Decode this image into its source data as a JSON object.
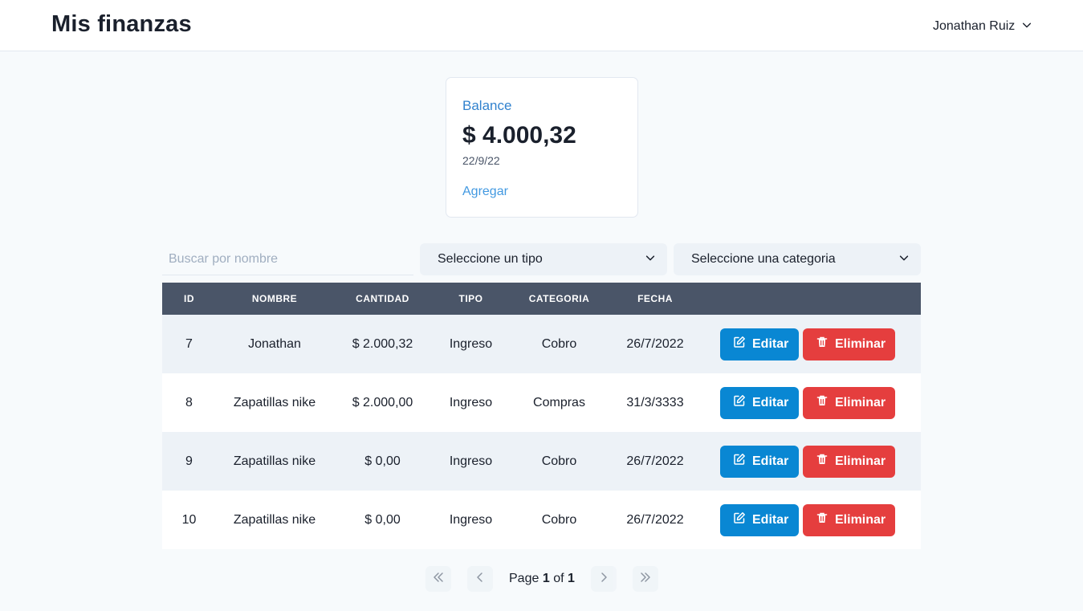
{
  "header": {
    "brand": "Mis finanzas",
    "user_name": "Jonathan Ruiz"
  },
  "balance": {
    "label": "Balance",
    "amount": "$ 4.000,32",
    "date": "22/9/22",
    "add_label": "Agregar"
  },
  "filters": {
    "search_placeholder": "Buscar por nombre",
    "tipo_selected": "Seleccione un tipo",
    "categoria_selected": "Seleccione una categoria"
  },
  "table": {
    "columns": [
      "ID",
      "NOMBRE",
      "CANTIDAD",
      "TIPO",
      "CATEGORIA",
      "FECHA"
    ],
    "rows": [
      {
        "id": "7",
        "nombre": "Jonathan",
        "cantidad": "$ 2.000,32",
        "tipo": "Ingreso",
        "categoria": "Cobro",
        "fecha": "26/7/2022"
      },
      {
        "id": "8",
        "nombre": "Zapatillas nike",
        "cantidad": "$ 2.000,00",
        "tipo": "Ingreso",
        "categoria": "Compras",
        "fecha": "31/3/3333"
      },
      {
        "id": "9",
        "nombre": "Zapatillas nike",
        "cantidad": "$ 0,00",
        "tipo": "Ingreso",
        "categoria": "Cobro",
        "fecha": "26/7/2022"
      },
      {
        "id": "10",
        "nombre": "Zapatillas nike",
        "cantidad": "$ 0,00",
        "tipo": "Ingreso",
        "categoria": "Cobro",
        "fecha": "26/7/2022"
      }
    ],
    "edit_label": "Editar",
    "delete_label": "Eliminar"
  },
  "pagination": {
    "page_word": "Page",
    "of_word": "of",
    "current_page": "1",
    "total_pages": "1"
  },
  "colors": {
    "edit_button": "#0987d3",
    "delete_button": "#e53e3e",
    "table_header": "#4a5568",
    "accent_link": "#3182ce"
  },
  "icons": {
    "user_menu": "chevron-down-icon",
    "edit": "edit-icon",
    "delete": "trash-icon",
    "first_page": "double-chevron-left-icon",
    "prev_page": "chevron-left-icon",
    "next_page": "chevron-right-icon",
    "last_page": "double-chevron-right-icon"
  }
}
